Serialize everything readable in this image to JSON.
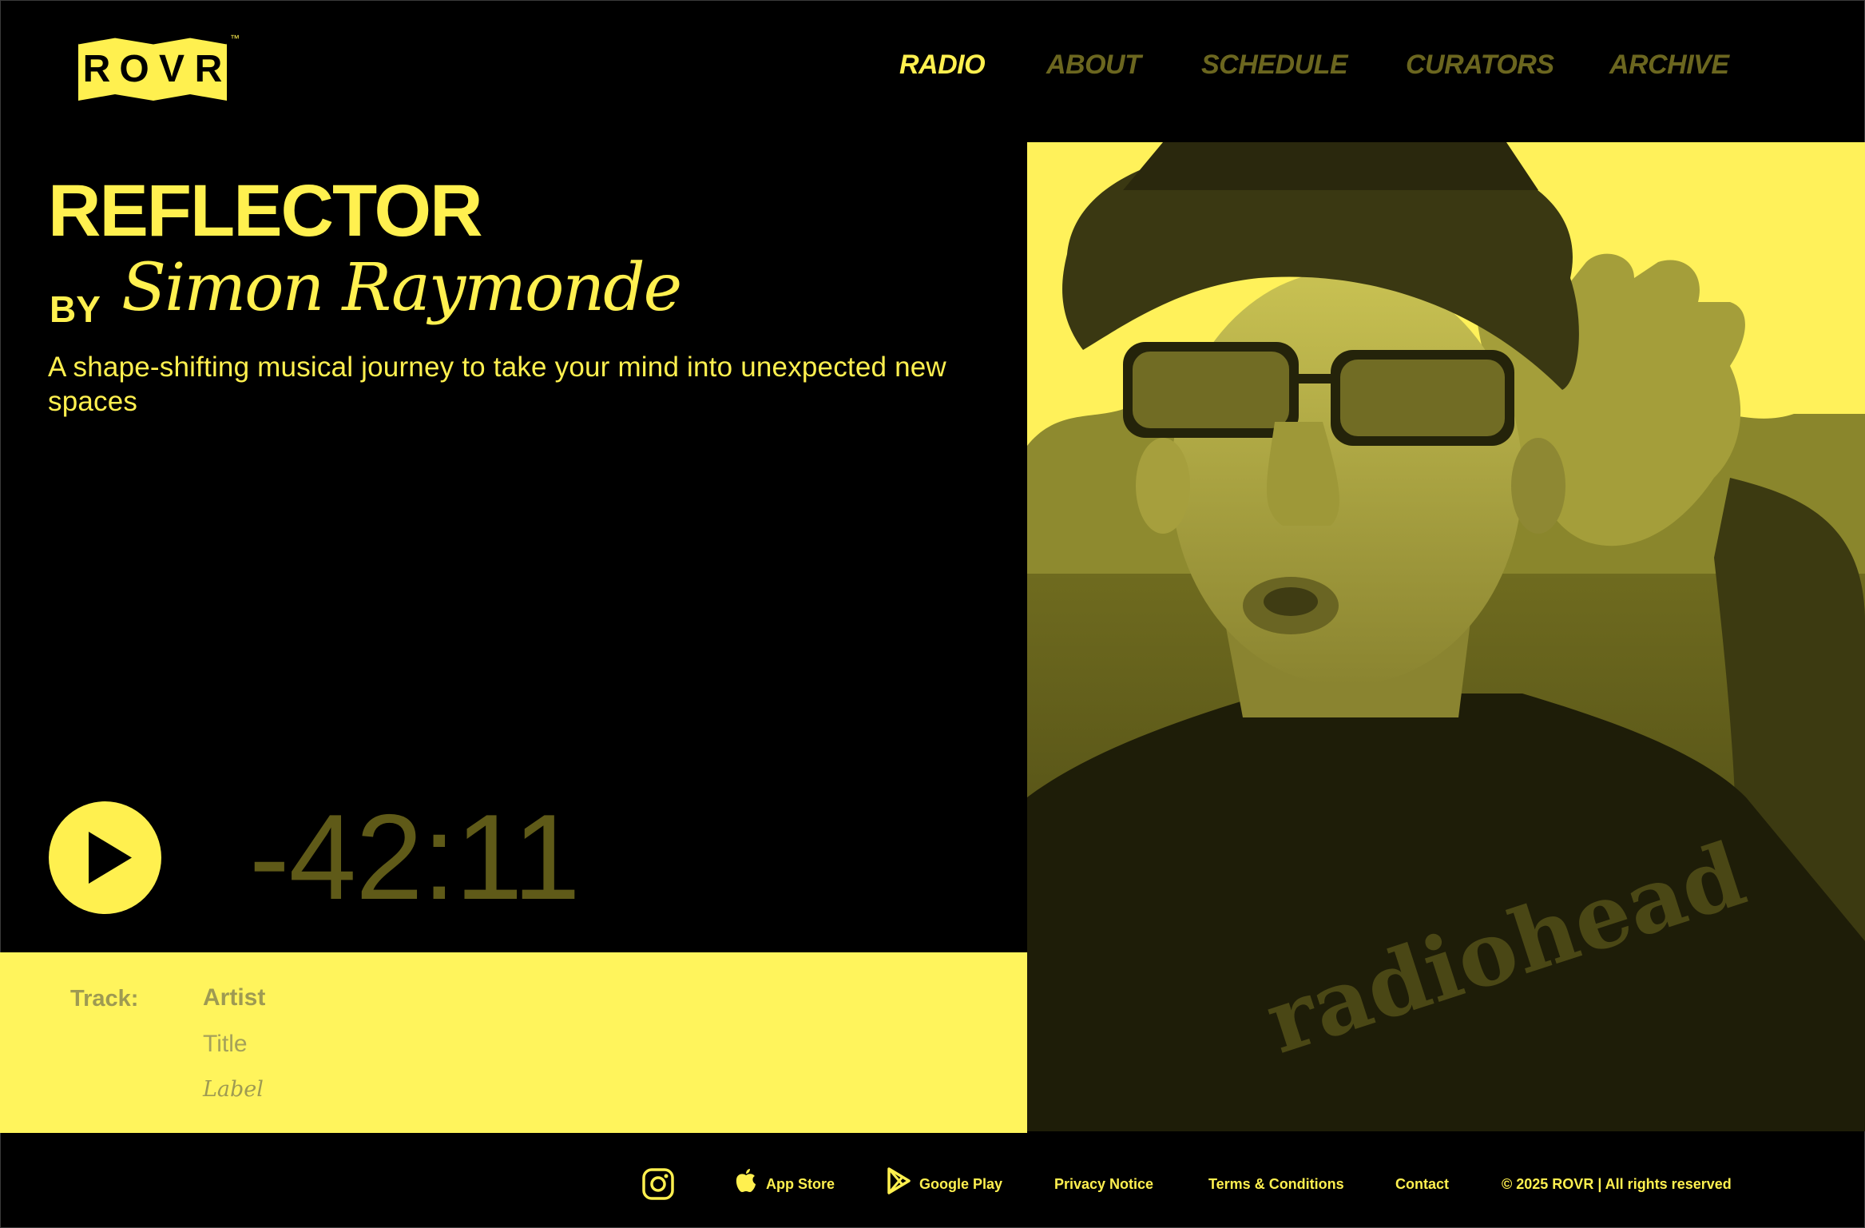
{
  "brand": {
    "logo_letters": [
      "R",
      "O",
      "V",
      "R"
    ],
    "trademark": "™"
  },
  "nav": {
    "items": [
      {
        "label": "RADIO",
        "active": true
      },
      {
        "label": "ABOUT",
        "active": false
      },
      {
        "label": "SCHEDULE",
        "active": false
      },
      {
        "label": "CURATORS",
        "active": false
      },
      {
        "label": "ARCHIVE",
        "active": false
      }
    ]
  },
  "show": {
    "title": "REFLECTOR",
    "by": "BY",
    "curator": "Simon Raymonde",
    "description": "A shape-shifting musical journey to take your mind into unexpected new spaces"
  },
  "player": {
    "time_remaining": "-42:11",
    "play_icon": "play-icon"
  },
  "track": {
    "heading": "Track:",
    "artist": "Artist",
    "title": "Title",
    "label": "Label"
  },
  "photo": {
    "shirt_text": "radiohead"
  },
  "footer": {
    "app_store": "App Store",
    "google_play": "Google Play",
    "privacy": "Privacy Notice",
    "terms": "Terms & Conditions",
    "contact": "Contact",
    "copyright": "© 2025 ROVR | All rights reserved"
  },
  "colors": {
    "accent": "#fff04f",
    "background": "#000000",
    "muted": "#6b661f",
    "panel": "#fff45c"
  }
}
